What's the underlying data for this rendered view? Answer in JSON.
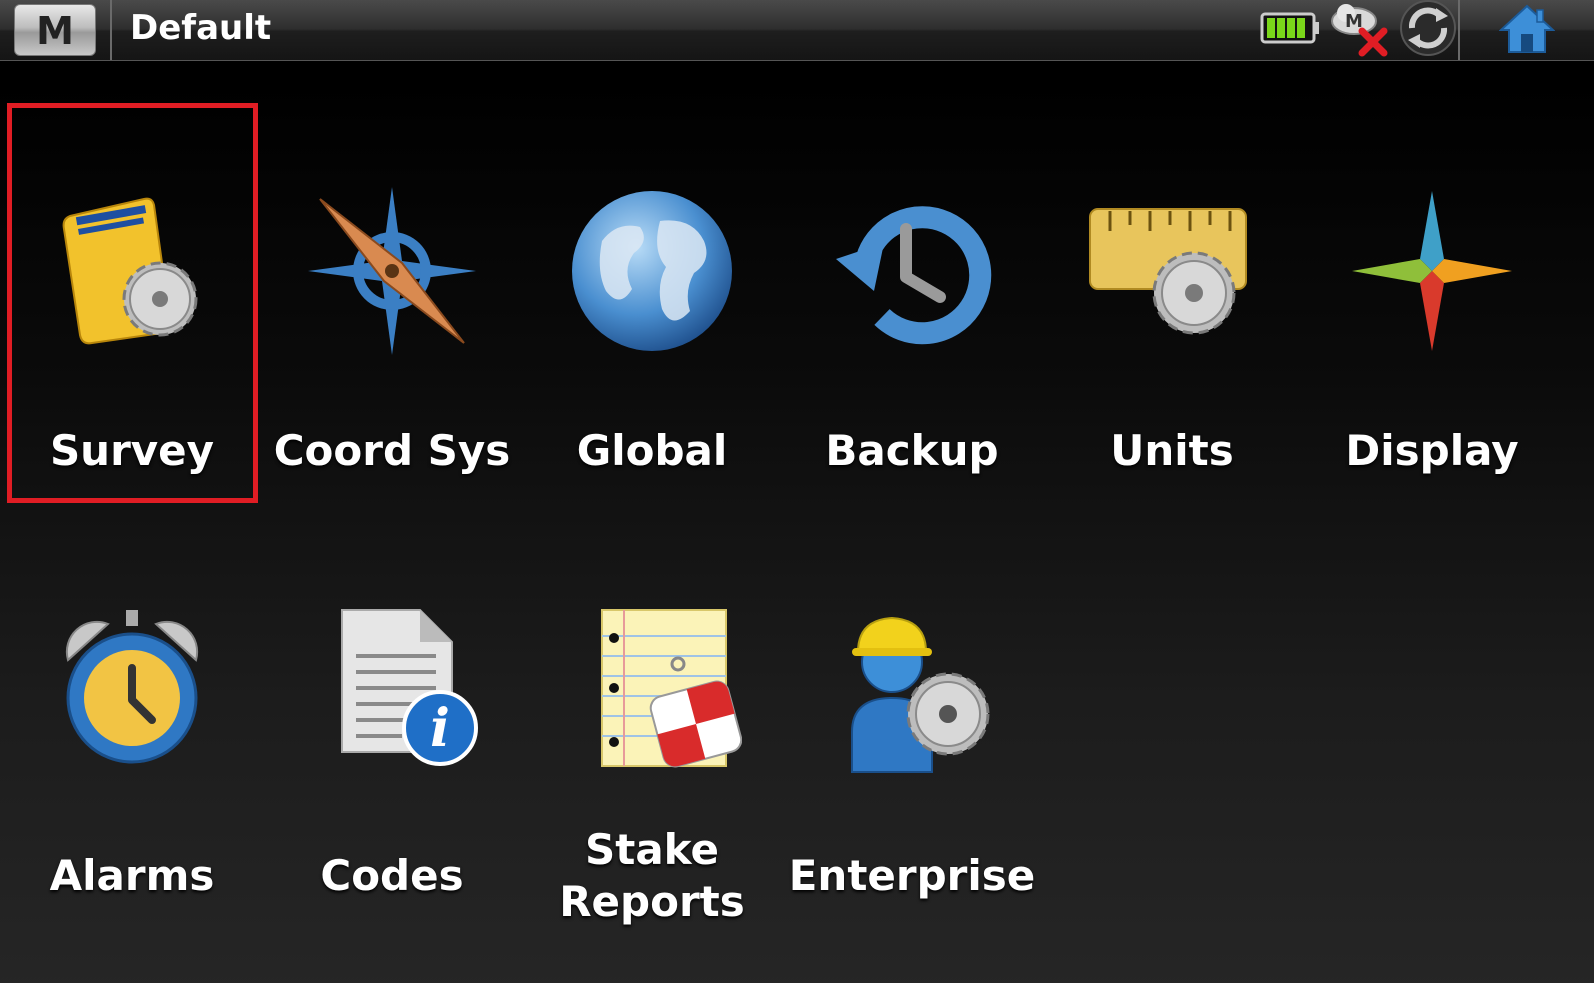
{
  "titlebar": {
    "menu_letter": "M",
    "title": "Default",
    "status_icons": [
      "battery-icon",
      "modem-disconnected-icon",
      "sync-icon"
    ],
    "home_icon": "home-icon"
  },
  "tiles": [
    {
      "label": "Survey",
      "icon": "survey-folder-gear-icon",
      "selected": true
    },
    {
      "label": "Coord Sys",
      "icon": "compass-icon"
    },
    {
      "label": "Global",
      "icon": "globe-icon"
    },
    {
      "label": "Backup",
      "icon": "backup-clock-icon"
    },
    {
      "label": "Units",
      "icon": "ruler-gear-icon"
    },
    {
      "label": "Display",
      "icon": "star-compass-icon"
    },
    {
      "label": "Alarms",
      "icon": "alarm-clock-icon"
    },
    {
      "label": "Codes",
      "icon": "document-info-icon"
    },
    {
      "label": "Stake\nReports",
      "icon": "notepad-target-icon"
    },
    {
      "label": "Enterprise",
      "icon": "worker-gear-icon"
    }
  ],
  "colors": {
    "selection": "#e01d24",
    "label": "#ffffff",
    "background": "#000000"
  }
}
